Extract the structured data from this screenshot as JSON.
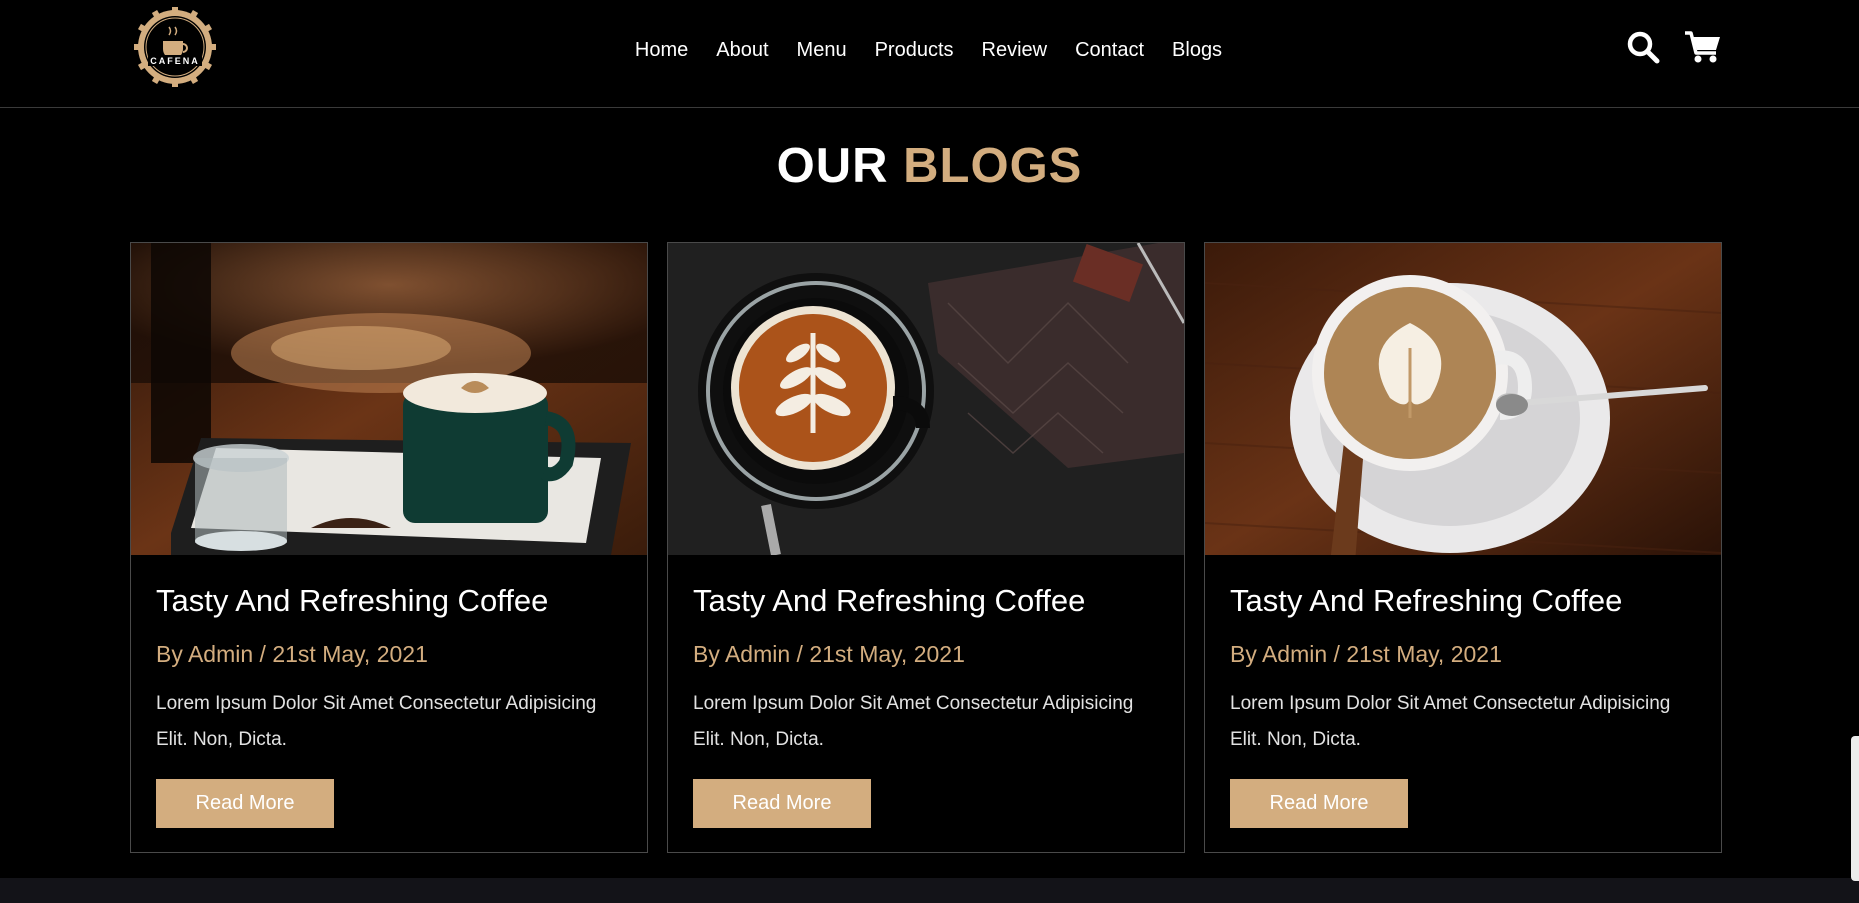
{
  "brand": {
    "logo_text": "CAFENA",
    "accent_color": "#d3ad7f"
  },
  "nav": {
    "items": [
      "Home",
      "About",
      "Menu",
      "Products",
      "Review",
      "Contact",
      "Blogs"
    ]
  },
  "header_icons": [
    "search-icon",
    "cart-icon"
  ],
  "section": {
    "title_main": "OUR",
    "title_accent": "BLOGS"
  },
  "blogs": [
    {
      "image": "coffee-green-mug-with-water-glass",
      "title": "Tasty And Refreshing Coffee",
      "meta": "By Admin / 21st May, 2021",
      "description": "Lorem Ipsum Dolor Sit Amet Consectetur Adipisicing Elit. Non, Dicta.",
      "button": "Read More"
    },
    {
      "image": "latte-art-black-cup-top-view",
      "title": "Tasty And Refreshing Coffee",
      "meta": "By Admin / 21st May, 2021",
      "description": "Lorem Ipsum Dolor Sit Amet Consectetur Adipisicing Elit. Non, Dicta.",
      "button": "Read More"
    },
    {
      "image": "latte-art-white-cup-with-spoon",
      "title": "Tasty And Refreshing Coffee",
      "meta": "By Admin / 21st May, 2021",
      "description": "Lorem Ipsum Dolor Sit Amet Consectetur Adipisicing Elit. Non, Dicta.",
      "button": "Read More"
    }
  ]
}
